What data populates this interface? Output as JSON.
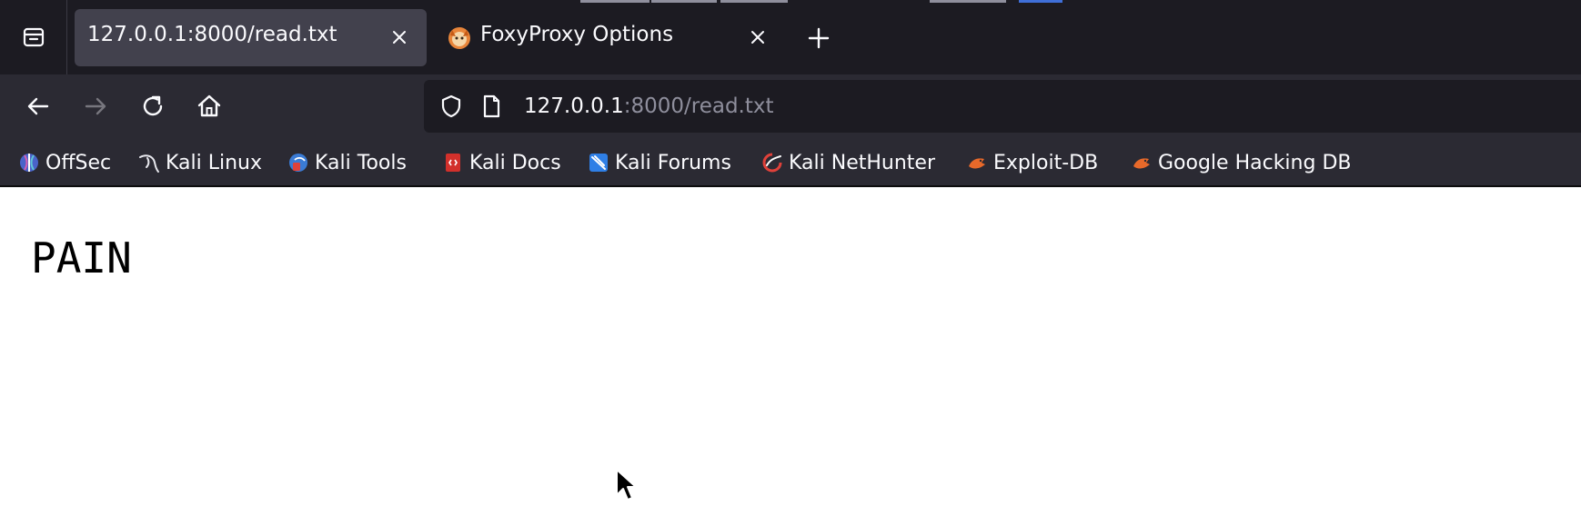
{
  "tabs": [
    {
      "title": "127.0.0.1:8000/read.txt",
      "active": true
    },
    {
      "title": "FoxyProxy Options",
      "active": false
    }
  ],
  "urlbar": {
    "host": "127.0.0.1",
    "rest": ":8000/read.txt"
  },
  "bookmarks": [
    {
      "label": "OffSec",
      "icon": "offsec-icon"
    },
    {
      "label": "Kali Linux",
      "icon": "kali-linux-icon"
    },
    {
      "label": "Kali Tools",
      "icon": "kali-tools-icon"
    },
    {
      "label": "Kali Docs",
      "icon": "kali-docs-icon"
    },
    {
      "label": "Kali Forums",
      "icon": "kali-forums-icon"
    },
    {
      "label": "Kali NetHunter",
      "icon": "kali-nethunter-icon"
    },
    {
      "label": "Exploit-DB",
      "icon": "exploit-db-icon"
    },
    {
      "label": "Google Hacking DB",
      "icon": "google-hacking-db-icon"
    }
  ],
  "page": {
    "text": "PAIN"
  },
  "colors": {
    "tabstrip": "#1c1b22",
    "toolbar": "#2b2a33",
    "active_tab": "#42414d",
    "text": "#fbfbfe",
    "muted_text": "#8f8f9d"
  }
}
